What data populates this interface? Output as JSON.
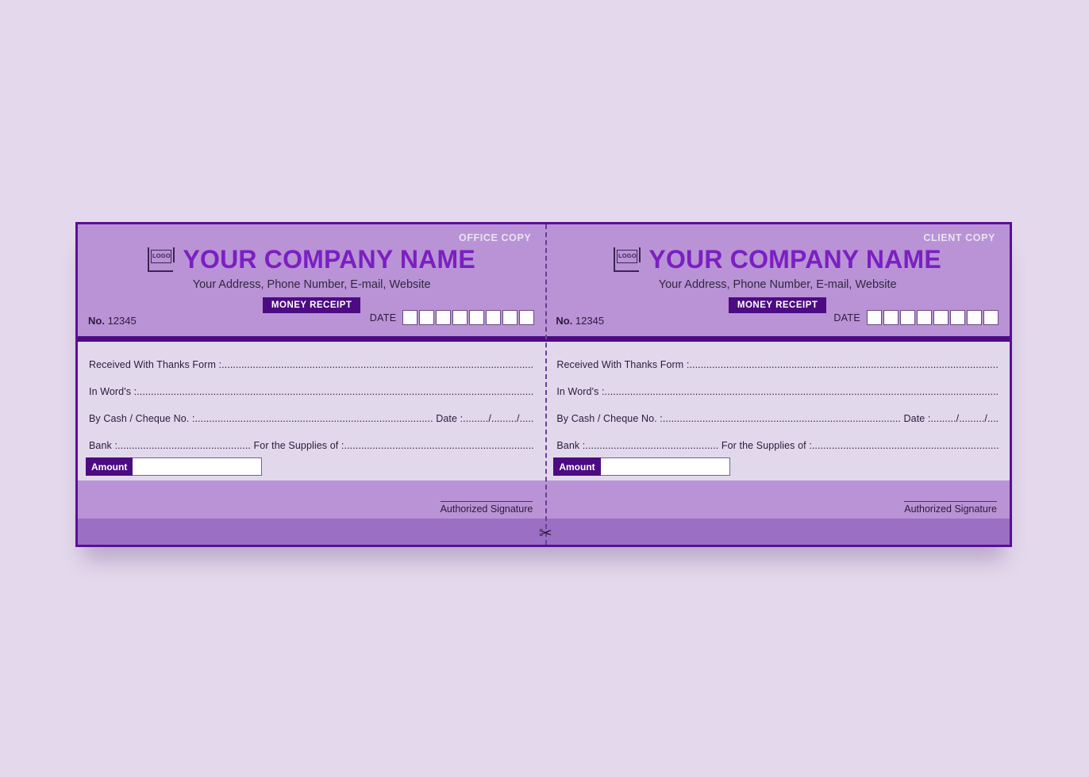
{
  "background_color": "#e4d9ec",
  "theme": {
    "accent_dark": "#4c0b82",
    "accent_mid": "#9a6fc4",
    "accent_light": "#b993d6",
    "body_bg": "#e2d8ec",
    "company_name_color": "#7b1fc1",
    "border_color": "#5b0f96"
  },
  "copies": [
    {
      "copy_tag": "OFFICE COPY",
      "logo_text": "LOGO",
      "company_name": "YOUR COMPANY NAME",
      "company_address": "Your Address, Phone Number, E-mail, Website",
      "receipt_badge": "MONEY RECEIPT",
      "no_label": "No.",
      "no_value": "12345",
      "date_label": "DATE",
      "date_box_count": 8,
      "form": {
        "received_line": "Received With Thanks Form :..............................................................................................................................",
        "in_words_line": "In Word's :.....................................................................................................................................................",
        "cheque_line": "By Cash / Cheque  No. :.................................................................................... Date :........./........./...............",
        "bank_line": "Bank :............................................... For the Supplies of :.............................................................................",
        "amount_label": "Amount",
        "amount_value": ""
      },
      "signature_label": "Authorized Signature"
    },
    {
      "copy_tag": "CLIENT COPY",
      "logo_text": "LOGO",
      "company_name": "YOUR COMPANY NAME",
      "company_address": "Your Address, Phone Number, E-mail, Website",
      "receipt_badge": "MONEY RECEIPT",
      "no_label": "No.",
      "no_value": "12345",
      "date_label": "DATE",
      "date_box_count": 8,
      "form": {
        "received_line": "Received With Thanks Form :..............................................................................................................................",
        "in_words_line": "In Word's :.....................................................................................................................................................",
        "cheque_line": "By Cash / Cheque  No. :.................................................................................... Date :........./........./...............",
        "bank_line": "Bank :............................................... For the Supplies of :.............................................................................",
        "amount_label": "Amount",
        "amount_value": ""
      },
      "signature_label": "Authorized Signature"
    }
  ],
  "perforation": {
    "icon": "scissors-icon",
    "glyph": "✂"
  }
}
